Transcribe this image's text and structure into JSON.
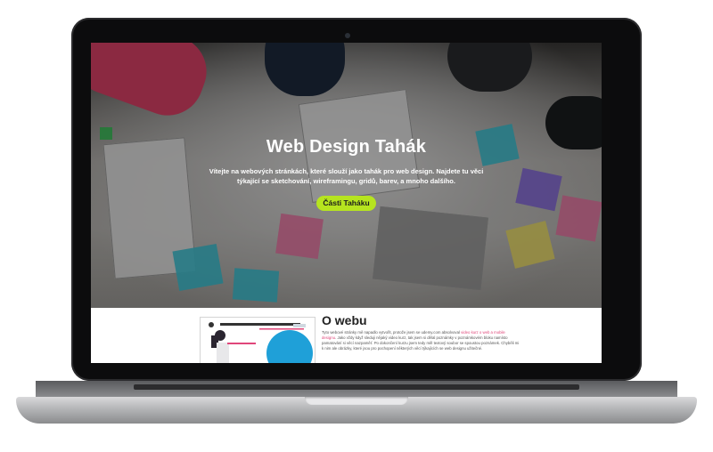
{
  "hero": {
    "title": "Web Design Tahák",
    "subtitle": "Vítejte na webových stránkách, které slouží jako tahák pro web design. Najdete tu věci týkající se sketchování, wireframingu, gridů, barev, a mnoho dalšího.",
    "button_label": "Části Taháku",
    "button_color": "#b6e41f"
  },
  "about": {
    "title": "O webu",
    "text_part1": "Tyto webové stránky mě napadlo vytvořit, protože jsem se udemy.com absolvoval ",
    "text_link": "video kurz o web a mobile designu",
    "text_part2": ". Jako vždy když sleduji nějaký video kurz, tak jsem si dělal poznámky v poznámkovém bloku namísto pamatování si věcí nazpaměť. Po dokončení kurzu jsem tedy měl textový soubor se spoustou poznámek. Chyběli mi k nim ale obrázky, které jsou pro pochopení některých věcí týkajících se web designu užitečné.",
    "link_color": "#e0467a"
  }
}
